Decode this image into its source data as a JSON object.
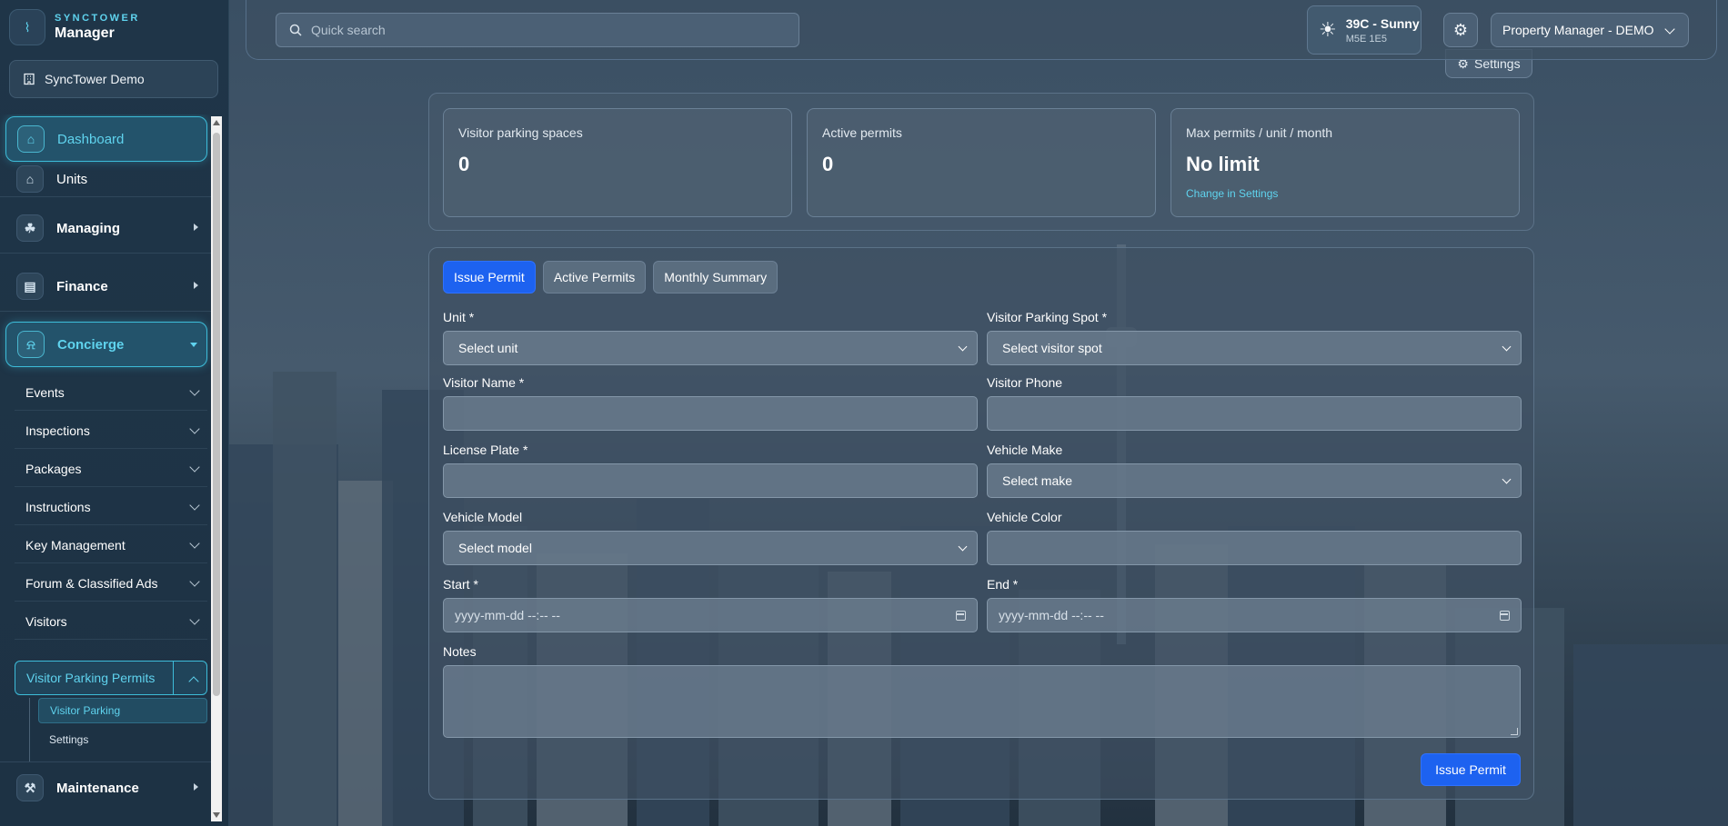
{
  "brand": {
    "top": "SYNCTOWER",
    "main": "Manager"
  },
  "building": {
    "name": "SyncTower Demo"
  },
  "nav": {
    "dashboard": "Dashboard",
    "units": "Units",
    "managing": "Managing",
    "finance": "Finance",
    "concierge": "Concierge",
    "maintenance": "Maintenance",
    "concierge_items": [
      "Events",
      "Inspections",
      "Packages",
      "Instructions",
      "Key Management",
      "Forum & Classified Ads",
      "Visitors"
    ],
    "visitor_parking_permits": "Visitor Parking Permits",
    "visitor_parking": "Visitor Parking",
    "settings": "Settings"
  },
  "topbar": {
    "search_placeholder": "Quick search",
    "weather_temp": "39C - Sunny",
    "weather_postal": "M5E 1E5",
    "role": "Property Manager - DEMO",
    "settings_label": "Settings"
  },
  "stats": [
    {
      "label": "Visitor parking spaces",
      "value": "0"
    },
    {
      "label": "Active permits",
      "value": "0"
    },
    {
      "label": "Max permits / unit / month",
      "value": "No limit",
      "link": "Change in Settings"
    }
  ],
  "tabs": [
    "Issue Permit",
    "Active Permits",
    "Monthly Summary"
  ],
  "form": {
    "unit_label": "Unit *",
    "unit_value": "Select unit",
    "spot_label": "Visitor Parking Spot *",
    "spot_value": "Select visitor spot",
    "name_label": "Visitor Name *",
    "phone_label": "Visitor Phone",
    "plate_label": "License Plate *",
    "make_label": "Vehicle Make",
    "make_value": "Select make",
    "model_label": "Vehicle Model",
    "model_value": "Select model",
    "color_label": "Vehicle Color",
    "start_label": "Start *",
    "end_label": "End *",
    "date_placeholder": "yyyy-mm-dd  --:--  --",
    "notes_label": "Notes",
    "submit": "Issue Permit"
  },
  "colors": {
    "accent": "#5fd3ee",
    "primary_button": "#1d62f0",
    "sidebar_bg": "#1f3548"
  }
}
